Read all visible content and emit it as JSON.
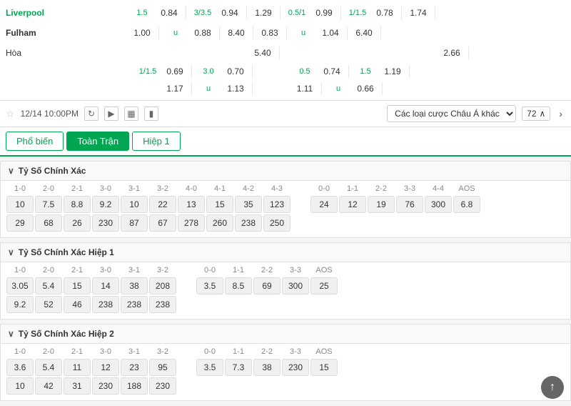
{
  "match": {
    "team1": "Liverpool",
    "team2": "Fulham",
    "draw": "Hòa",
    "datetime": "12/14 10:00PM",
    "betTypeLabel": "Các loại cược Châu Á khác",
    "count": "72"
  },
  "odds": {
    "row1": [
      {
        "handicap": "1.5",
        "value": "0.84"
      },
      {
        "handicap": "3/3.5",
        "value": "0.94"
      },
      {
        "handicap": "",
        "value": "1.29"
      },
      {
        "handicap": "0.5/1",
        "value": "0.99"
      },
      {
        "handicap": "1/1.5",
        "value": "0.78"
      },
      {
        "handicap": "",
        "value": "1.74"
      }
    ],
    "row2": [
      {
        "handicap": "",
        "value": "1.00"
      },
      {
        "handicap": "u",
        "value": "0.88"
      },
      {
        "handicap": "",
        "value": "8.40"
      },
      {
        "handicap": "",
        "value": "0.83"
      },
      {
        "handicap": "u",
        "value": "1.04"
      },
      {
        "handicap": "",
        "value": "6.40"
      }
    ],
    "row3_draw": [
      {
        "handicap": "",
        "value": "5.40"
      },
      {
        "handicap": "",
        "value": "2.66"
      }
    ],
    "subrow1": [
      {
        "handicap": "1/1.5",
        "value": "0.69"
      },
      {
        "handicap": "3.0",
        "value": "0.70"
      },
      {
        "handicap": "0.5",
        "value": "0.74"
      },
      {
        "handicap": "1.5",
        "value": "1.19"
      }
    ],
    "subrow2": [
      {
        "handicap": "",
        "value": "1.17"
      },
      {
        "handicap": "u",
        "value": "1.13"
      },
      {
        "handicap": "",
        "value": "1.11"
      },
      {
        "handicap": "u",
        "value": "0.66"
      }
    ]
  },
  "tabs": {
    "items": [
      "Phổ biến",
      "Toàn Trận",
      "Hiệp 1"
    ]
  },
  "sections": [
    {
      "id": "tychinhxac",
      "title": "Tỷ Số Chính Xác",
      "labels1": [
        "1-0",
        "2-0",
        "2-1",
        "3-0",
        "3-1",
        "3-2",
        "4-0",
        "4-1",
        "4-2",
        "4-3"
      ],
      "values1a": [
        "10",
        "7.5",
        "8.8",
        "9.2",
        "10",
        "22",
        "13",
        "15",
        "35",
        "123"
      ],
      "values1b": [
        "29",
        "68",
        "26",
        "230",
        "87",
        "67",
        "278",
        "260",
        "238",
        "250"
      ],
      "labels2": [
        "0-0",
        "1-1",
        "2-2",
        "3-3",
        "4-4",
        "AOS"
      ],
      "values2a": [
        "24",
        "12",
        "19",
        "76",
        "300",
        "6.8"
      ],
      "values2b": []
    },
    {
      "id": "tychinhxachiep1",
      "title": "Tỷ Số Chính Xác Hiệp 1",
      "labels1": [
        "1-0",
        "2-0",
        "2-1",
        "3-0",
        "3-1",
        "3-2"
      ],
      "values1a": [
        "3.05",
        "5.4",
        "15",
        "14",
        "38",
        "208"
      ],
      "values1b": [
        "9.2",
        "52",
        "46",
        "238",
        "238",
        "238"
      ],
      "labels2": [
        "0-0",
        "1-1",
        "2-2",
        "3-3",
        "AOS"
      ],
      "values2a": [
        "3.5",
        "8.5",
        "69",
        "300",
        "25"
      ],
      "values2b": []
    },
    {
      "id": "tychinhxachiep2",
      "title": "Tỷ Số Chính Xác Hiệp 2",
      "labels1": [
        "1-0",
        "2-0",
        "2-1",
        "3-0",
        "3-1",
        "3-2"
      ],
      "values1a": [
        "3.6",
        "5.4",
        "11",
        "12",
        "23",
        "95"
      ],
      "values1b": [
        "10",
        "42",
        "31",
        "230",
        "188",
        "230"
      ],
      "labels2": [
        "0-0",
        "1-1",
        "2-2",
        "3-3",
        "AOS"
      ],
      "values2a": [
        "3.5",
        "7.3",
        "38",
        "230",
        "15"
      ],
      "values2b": []
    }
  ],
  "icons": {
    "star": "☆",
    "refresh": "↻",
    "play": "▶",
    "table": "▦",
    "chart": "▮",
    "chevron_down": "∨",
    "chevron_up": "∧",
    "arrow_right": "›",
    "back_top": "↑"
  }
}
